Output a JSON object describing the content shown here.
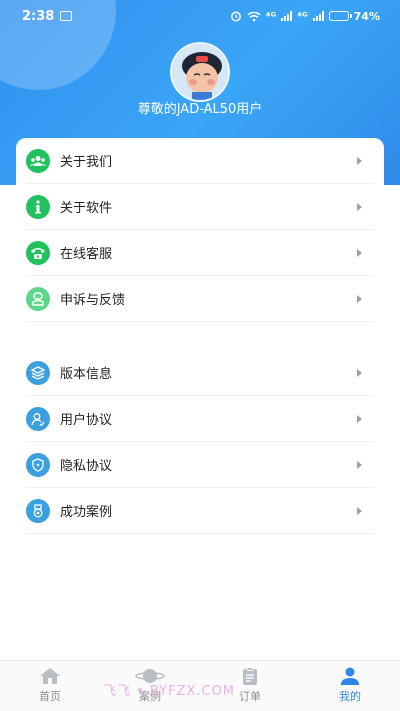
{
  "status_bar": {
    "time": "2:38",
    "network_a": "⁴ᴳ",
    "network_b": "⁴ᴳ",
    "battery": "74%",
    "battery_level": 0.74
  },
  "profile": {
    "username": "尊敬的JAD-AL50用户"
  },
  "menu_group_1": [
    {
      "label": "关于我们",
      "icon": "users-icon",
      "color": "#21c25e"
    },
    {
      "label": "关于软件",
      "icon": "info-icon",
      "color": "#21c25e"
    },
    {
      "label": "在线客服",
      "icon": "phone-icon",
      "color": "#21c25e"
    },
    {
      "label": "申诉与反馈",
      "icon": "feedback-icon",
      "color": "#5ed78a"
    }
  ],
  "menu_group_2": [
    {
      "label": "版本信息",
      "icon": "layers-icon",
      "color": "#3aa0e0"
    },
    {
      "label": "用户协议",
      "icon": "user-agreement-icon",
      "color": "#3aa0e0"
    },
    {
      "label": "隐私协议",
      "icon": "shield-icon",
      "color": "#3aa0e0"
    },
    {
      "label": "成功案例",
      "icon": "medal-icon",
      "color": "#3aa0e0"
    }
  ],
  "tabs": [
    {
      "label": "首页",
      "icon": "home-icon"
    },
    {
      "label": "案例",
      "icon": "planet-icon"
    },
    {
      "label": "订单",
      "icon": "clipboard-icon"
    },
    {
      "label": "我的",
      "icon": "person-icon",
      "active": true
    }
  ],
  "watermark": "飞飞 • BYFZX.COM",
  "accent_color": "#2f86e8"
}
